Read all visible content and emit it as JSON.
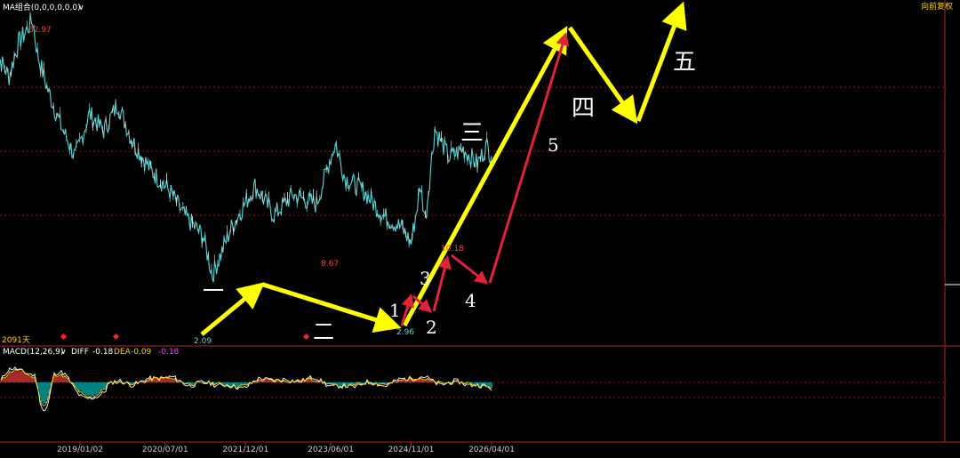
{
  "header": {
    "indicator_label": "MA组合(0,0,0,0,0,0)",
    "dropdown_glyph": "∨",
    "price_mode": "向前复权"
  },
  "main_panel": {
    "annotations": {
      "peak_price": "32.97",
      "low_price_1": "2.09",
      "mid_high_price": "8.67",
      "low_price_2": "2.96",
      "recent_high_price": "10.18",
      "day_count": "2091天"
    },
    "waves_large": [
      "一",
      "二",
      "三",
      "四",
      "五"
    ],
    "waves_small": [
      "1",
      "2",
      "3",
      "4",
      "5"
    ]
  },
  "macd_panel": {
    "label": "MACD(12,26,9)",
    "diff_label": "DIFF",
    "diff_value": "-0.18",
    "dea_label": "DEA",
    "dea_value": "-0.09",
    "macd_value": "-0.18"
  },
  "chart_data": {
    "type": "line",
    "x_dates": [
      "2019/01/02",
      "2020/07/01",
      "2021/12/01",
      "2023/06/01",
      "2024/11/01",
      "2026/04/01"
    ],
    "price_series": {
      "name": "",
      "color": "#5ad4d4",
      "description_points": [
        {
          "date": "2017/07",
          "price": 24.0
        },
        {
          "date": "2017/10",
          "price": 18.0
        },
        {
          "date": "2017/12",
          "price": 26.0
        },
        {
          "date": "2018/02",
          "price": 30.5
        },
        {
          "date": "2018/03",
          "price": 32.97
        },
        {
          "date": "2018/04",
          "price": 23.0
        },
        {
          "date": "2018/06",
          "price": 16.0
        },
        {
          "date": "2018/09",
          "price": 10.5
        },
        {
          "date": "2018/12",
          "price": 7.5
        },
        {
          "date": "2019/03",
          "price": 12.0
        },
        {
          "date": "2019/06",
          "price": 10.0
        },
        {
          "date": "2019/09",
          "price": 13.3
        },
        {
          "date": "2019/12",
          "price": 9.0
        },
        {
          "date": "2020/04",
          "price": 6.5
        },
        {
          "date": "2020/08",
          "price": 5.2
        },
        {
          "date": "2020/11",
          "price": 4.0
        },
        {
          "date": "2021/03",
          "price": 3.2
        },
        {
          "date": "2021/05",
          "price": 2.09
        },
        {
          "date": "2021/09",
          "price": 3.5
        },
        {
          "date": "2022/02",
          "price": 5.5
        },
        {
          "date": "2022/06",
          "price": 4.0
        },
        {
          "date": "2022/10",
          "price": 5.0
        },
        {
          "date": "2023/03",
          "price": 4.5
        },
        {
          "date": "2023/06",
          "price": 7.5
        },
        {
          "date": "2023/07",
          "price": 8.67
        },
        {
          "date": "2023/09",
          "price": 6.0
        },
        {
          "date": "2024/01",
          "price": 5.2
        },
        {
          "date": "2024/05",
          "price": 4.0
        },
        {
          "date": "2024/09",
          "price": 3.5
        },
        {
          "date": "2024/11",
          "price": 2.96
        },
        {
          "date": "2025/01",
          "price": 5.5
        },
        {
          "date": "2025/02",
          "price": 3.8
        },
        {
          "date": "2025/04",
          "price": 10.18
        },
        {
          "date": "2025/07",
          "price": 7.5
        },
        {
          "date": "2025/10",
          "price": 8.2
        },
        {
          "date": "2026/01",
          "price": 7.0
        },
        {
          "date": "2026/03",
          "price": 8.5
        },
        {
          "date": "2026/04",
          "price": 7.6
        }
      ]
    },
    "ylim": [
      1,
      36
    ],
    "grid": "horizontal dashed red",
    "macd": {
      "diff": -0.18,
      "dea": -0.09,
      "macd": -0.18
    },
    "colors": {
      "background": "#000000",
      "price_line": "#5ad4d4",
      "grid": "#8b1a1a",
      "axis": "#b22222",
      "wave_arrows": "#ffff00",
      "sub_wave_arrows": "#e0223a",
      "macd_pos": "#ff4040",
      "macd_neg": "#00c8c8",
      "diff_line": "#ffffff",
      "dea_line": "#ffd000"
    }
  }
}
